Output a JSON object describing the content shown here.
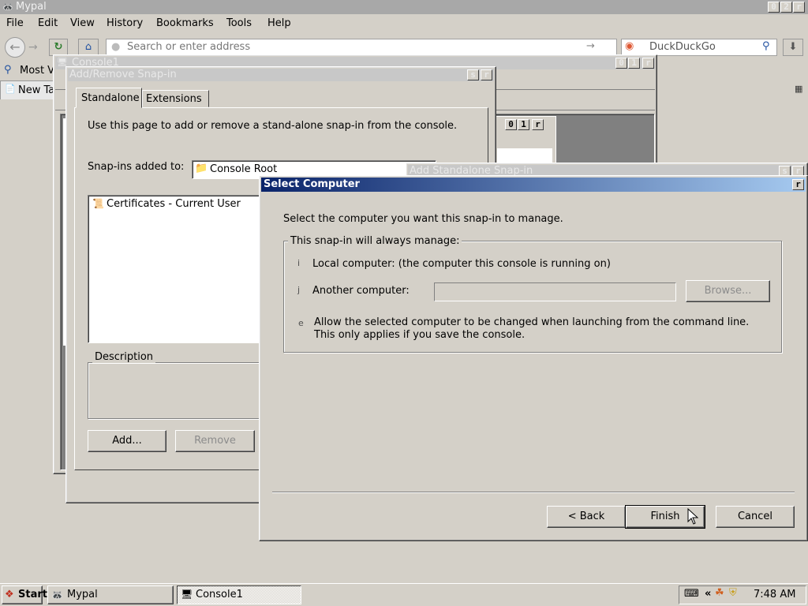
{
  "browser": {
    "title": "Mypal",
    "window_buttons": [
      "0",
      "2",
      "r"
    ],
    "menu": [
      "File",
      "Edit",
      "View",
      "History",
      "Bookmarks",
      "Tools",
      "Help"
    ],
    "address_placeholder": "Search or enter address",
    "search_engine": "DuckDuckGo",
    "bookmark_truncated": "Most V",
    "tab_truncated": "New Ta"
  },
  "console_window": {
    "title": "Console1",
    "buttons": [
      "0",
      "1",
      "r"
    ],
    "inner_buttons": [
      "0",
      "1",
      "r"
    ]
  },
  "addremove_dialog": {
    "title": "Add/Remove Snap-in",
    "title_buttons": [
      "s",
      "r"
    ],
    "tabs": [
      "Standalone",
      "Extensions"
    ],
    "intro": "Use this page to add or remove a stand-alone snap-in from the console.",
    "added_to_label": "Snap-ins added to:",
    "added_to_value": "Console Root",
    "list_items": [
      "Certificates - Current User"
    ],
    "description_label": "Description",
    "add_button": "Add...",
    "remove_button": "Remove"
  },
  "standalone_dialog": {
    "title": "Add Standalone Snap-in",
    "title_buttons": [
      "s",
      "r"
    ]
  },
  "select_computer": {
    "title": "Select Computer",
    "close_glyph": "r",
    "intro": "Select the computer you want this snap-in to manage.",
    "group_label": "This snap-in will always manage:",
    "option_local_glyph": "i",
    "option_local": "Local computer:  (the computer this console is running on)",
    "option_another_glyph": "j",
    "option_another": "Another computer:",
    "another_value": "",
    "browse_button": "Browse...",
    "check_glyph": "e",
    "allow_change_line1": "Allow the selected computer to be changed when launching from the command line.",
    "allow_change_line2": "This only applies if you save the console.",
    "back_button": "< Back",
    "finish_button": "Finish",
    "cancel_button": "Cancel"
  },
  "taskbar": {
    "start": "Start",
    "tasks": [
      "Mypal",
      "Console1"
    ],
    "clock": "7:48 AM"
  },
  "colors": {
    "desktop": "#d4d0c8",
    "active_title_start": "#0a246a",
    "active_title_end": "#a6caf0"
  }
}
